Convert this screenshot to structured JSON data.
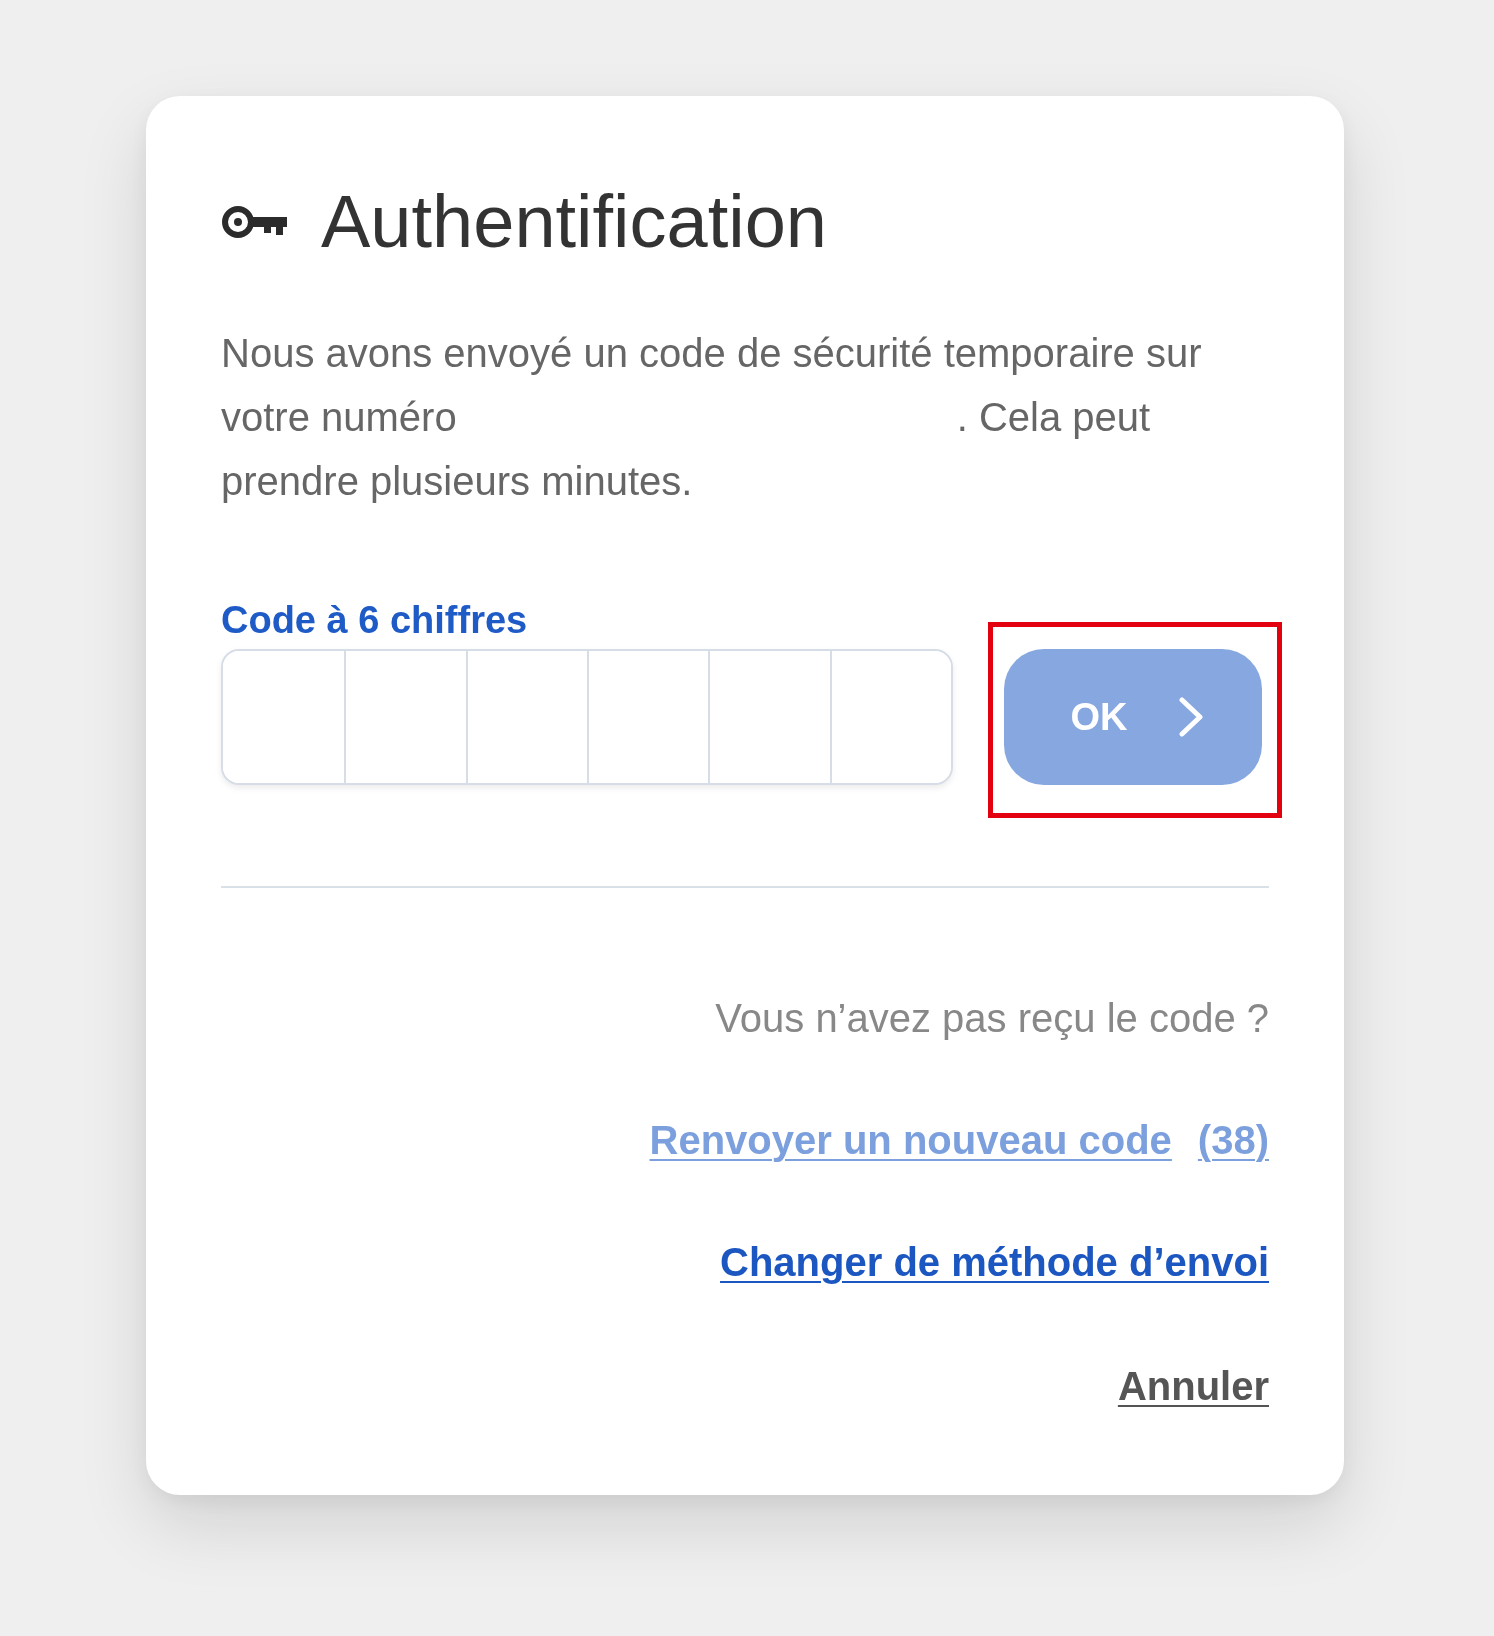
{
  "dialog": {
    "title": "Authentification",
    "message": {
      "text_before_number": "Nous avons envoyé un code de sécurité temporaire sur votre numéro",
      "text_after_number": ". Cela peut prendre plusieurs minutes."
    },
    "code_field": {
      "label": "Code à 6 chiffres"
    },
    "ok_button": {
      "label": "OK",
      "disabled": true,
      "highlighted": true
    },
    "resend": {
      "question": "Vous n’avez pas reçu le code ?",
      "link": "Renvoyer un nouveau code",
      "countdown": "(38)",
      "disabled": true
    },
    "change_method_link": {
      "label": "Changer de méthode d’envoi"
    },
    "cancel_link": {
      "label": "Annuler"
    }
  }
}
